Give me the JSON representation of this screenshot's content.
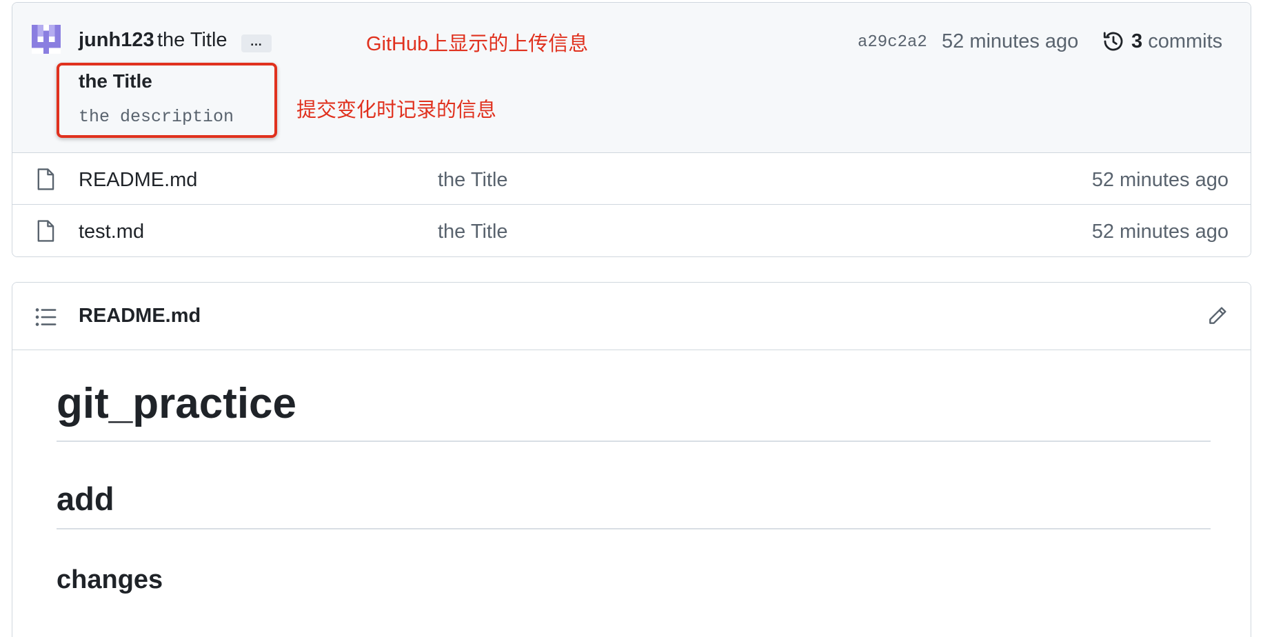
{
  "commit": {
    "author": "junh123",
    "title_inline": "the Title",
    "ellipsis": "…",
    "sha": "a29c2a2",
    "time": "52 minutes ago",
    "commits_count": "3",
    "commits_label": "commits",
    "message_title": "the Title",
    "message_description": "the description"
  },
  "annotations": {
    "top": "GitHub上显示的上传信息",
    "middle": "提交变化时记录的信息",
    "color": "#e0311e"
  },
  "files": [
    {
      "name": "README.md",
      "message": "the Title",
      "time": "52 minutes ago"
    },
    {
      "name": "test.md",
      "message": "the Title",
      "time": "52 minutes ago"
    }
  ],
  "readme": {
    "filename": "README.md",
    "h1": "git_practice",
    "h2": "add",
    "h3": "changes"
  },
  "icons": [
    "identicon-avatar",
    "history-icon",
    "file-icon",
    "list-icon",
    "pencil-icon"
  ]
}
